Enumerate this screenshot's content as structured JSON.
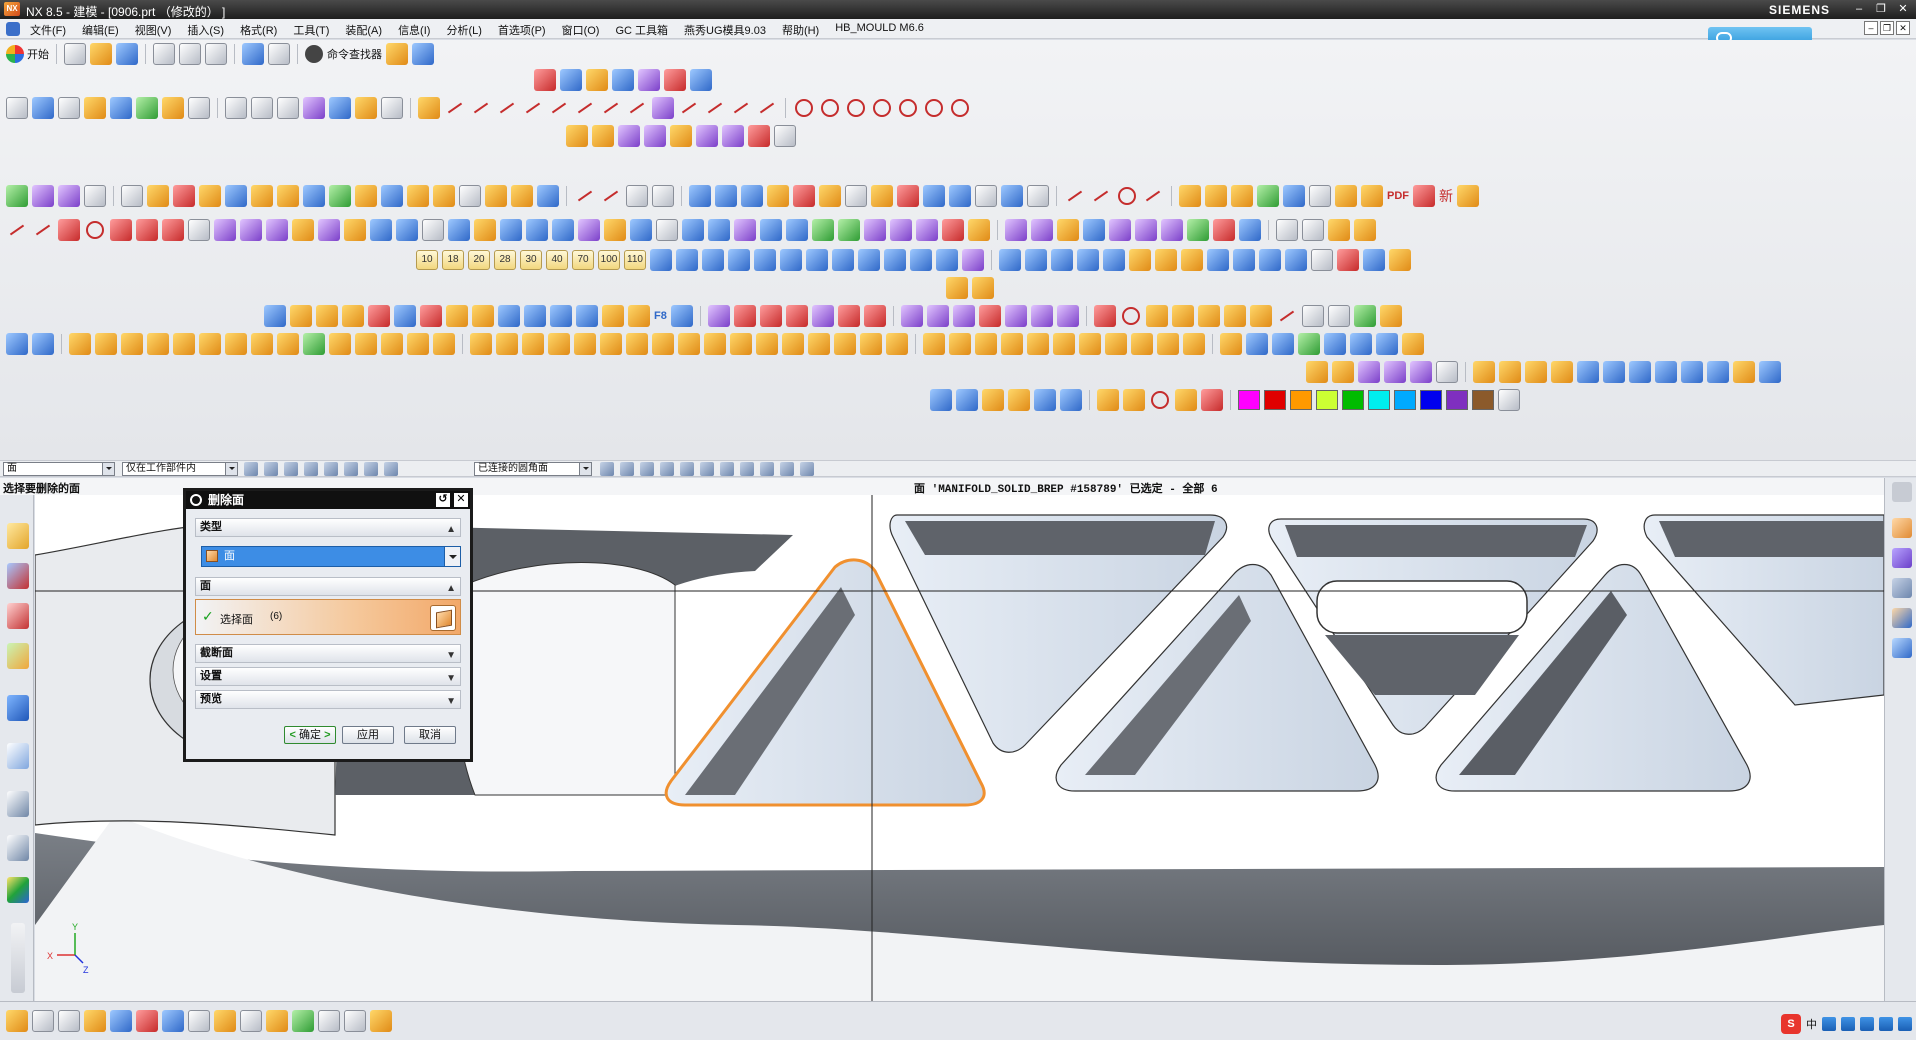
{
  "titlebar": {
    "title": "NX 8.5 - 建模 - [0906.prt （修改的） ]",
    "brand": "SIEMENS",
    "minimize": "–",
    "restore": "❐",
    "close": "✕"
  },
  "menubar": {
    "items": [
      "文件(F)",
      "编辑(E)",
      "视图(V)",
      "插入(S)",
      "格式(R)",
      "工具(T)",
      "装配(A)",
      "信息(I)",
      "分析(L)",
      "首选项(P)",
      "窗口(O)",
      "GC 工具箱",
      "燕秀UG模具9.03",
      "帮助(H)",
      "HB_MOULD M6.6"
    ],
    "doc_controls": [
      "–",
      "❐",
      "✕"
    ]
  },
  "cloud_button": {
    "label": ""
  },
  "toolbar": {
    "start_label": "开始",
    "command_finder_label": "命令查找器",
    "number_buttons": [
      "10",
      "18",
      "20",
      "28",
      "30",
      "40",
      "70",
      "100",
      "110"
    ],
    "f8_label": "F8",
    "pdf_label": "PDF",
    "new_label": "新",
    "colors": [
      "#ff00ff",
      "#e00000",
      "#ff9900",
      "#ccff33",
      "#00bb00",
      "#00eeee",
      "#00aaff",
      "#0000ee",
      "#7f2fbf",
      "#8b5a2b"
    ]
  },
  "selection_bar": {
    "type_filter": "面",
    "scope_filter": "仅在工作部件内",
    "face_rule": "已连接的圆角面"
  },
  "cue": {
    "prompt": "选择要删除的面",
    "status": "面 'MANIFOLD_SOLID_BREP #158789' 已选定 - 全部 6"
  },
  "dialog": {
    "title": "删除面",
    "reset": "↺",
    "close": "✕",
    "groups": {
      "type": "类型",
      "face": "面",
      "cross_section": "截断面",
      "settings": "设置",
      "preview": "预览"
    },
    "type_value": "面",
    "select_face_label": "选择面",
    "select_face_count": "(6)",
    "buttons": {
      "ok": "确定",
      "apply": "应用",
      "cancel": "取消"
    }
  },
  "triad": {
    "x": "X",
    "y": "Y",
    "z": "Z"
  },
  "tray": {
    "ime": "S",
    "lang": "中"
  }
}
